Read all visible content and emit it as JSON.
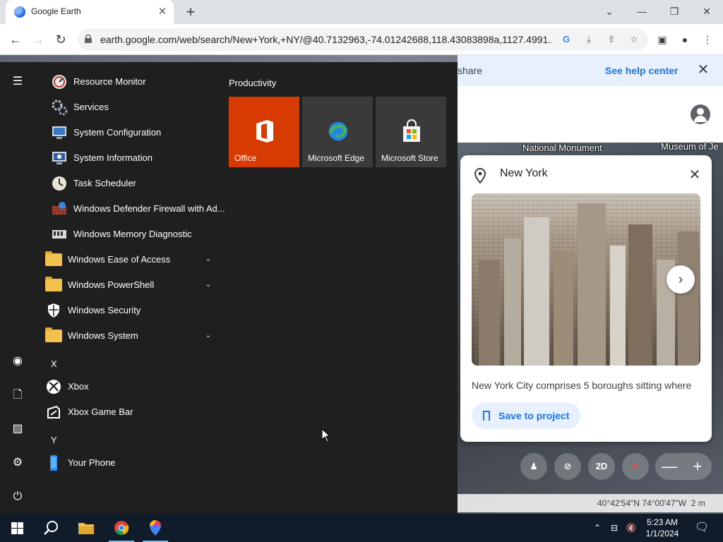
{
  "browser": {
    "tab_title": "Google Earth",
    "tab_close": "✕",
    "new_tab": "+",
    "url": "earth.google.com/web/search/New+York,+NY/@40.7132963,-74.01242688,118.43083898a,1127.4991...",
    "window_buttons": [
      "⌄",
      "—",
      "❐",
      "✕"
    ]
  },
  "earth": {
    "banner_text": "share",
    "banner_link": "See help center",
    "banner_close": "✕",
    "map_labels": [
      "National Monument",
      "Museum of Je"
    ],
    "place": {
      "title": "New York",
      "description": "New York City comprises 5 boroughs sitting where",
      "save_label": "Save to project",
      "close": "✕",
      "next": "›"
    },
    "controls": {
      "view_2d": "2D",
      "zoom_out": "—",
      "zoom_in": "+"
    },
    "coordinates": "40°42'54\"N 74°00'47\"W",
    "scale": "2 m"
  },
  "start_menu": {
    "apps": [
      {
        "label": "Resource Monitor",
        "icon": "resource-monitor-icon"
      },
      {
        "label": "Services",
        "icon": "services-gear-icon"
      },
      {
        "label": "System Configuration",
        "icon": "system-configuration-icon"
      },
      {
        "label": "System Information",
        "icon": "system-information-icon"
      },
      {
        "label": "Task Scheduler",
        "icon": "task-scheduler-clock-icon"
      },
      {
        "label": "Windows Defender Firewall with Ad...",
        "icon": "firewall-icon"
      },
      {
        "label": "Windows Memory Diagnostic",
        "icon": "memory-diagnostic-icon"
      }
    ],
    "folders": [
      {
        "label": "Windows Ease of Access"
      },
      {
        "label": "Windows PowerShell"
      }
    ],
    "security": {
      "label": "Windows Security"
    },
    "system_folder": {
      "label": "Windows System"
    },
    "letter_x": "X",
    "xbox": {
      "label": "Xbox"
    },
    "xbox_game_bar": {
      "label": "Xbox Game Bar"
    },
    "letter_y": "Y",
    "your_phone": {
      "label": "Your Phone"
    },
    "tiles_header": "Productivity",
    "tiles": [
      {
        "label": "Office",
        "color": "#d83b01"
      },
      {
        "label": "Microsoft Edge",
        "color": "#3a3a3a"
      },
      {
        "label": "Microsoft Store",
        "color": "#3a3a3a"
      }
    ]
  },
  "taskbar": {
    "time": "5:23 AM",
    "date": "1/1/2024",
    "accent": "#101c2a"
  }
}
